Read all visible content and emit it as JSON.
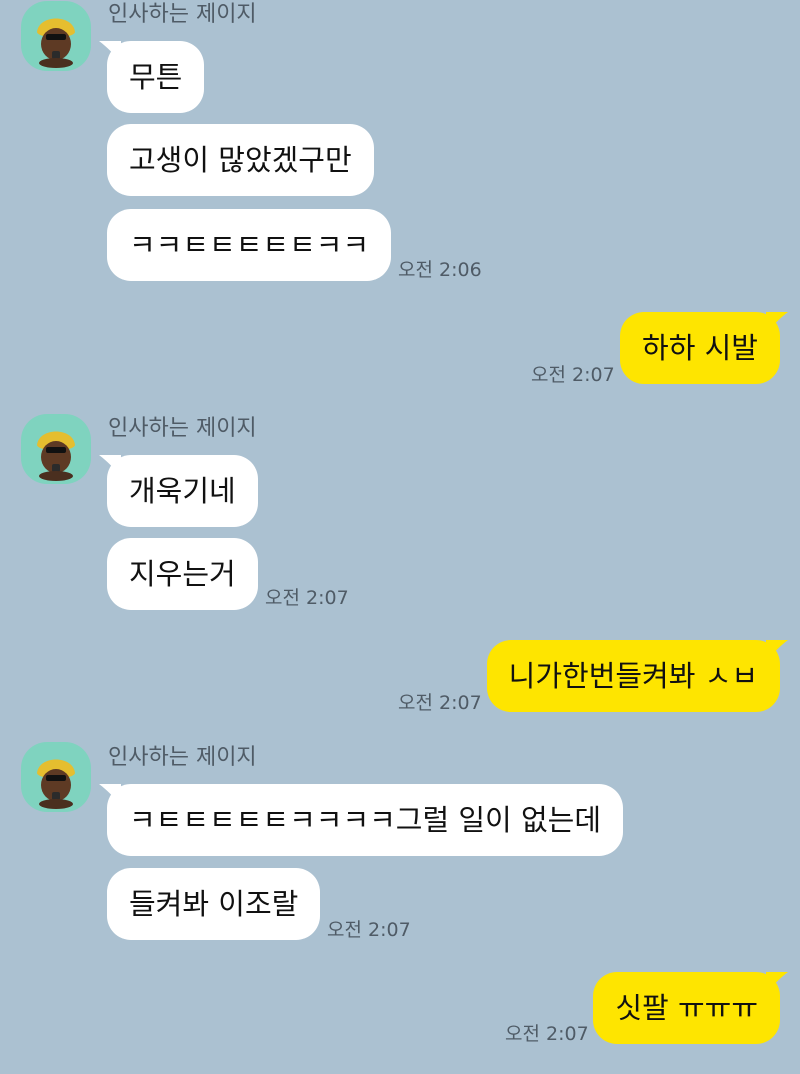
{
  "messages": [
    {
      "direction": "incoming",
      "sender": "인사하는 제이지",
      "bubbles": [
        "무튼",
        "고생이 많았겠구만",
        "ㅋㅋㅌㅌㅌㅌㅌㅋㅋ"
      ],
      "time": "오전 2:06"
    },
    {
      "direction": "outgoing",
      "bubbles": [
        "하하 시발"
      ],
      "time": "오전 2:07"
    },
    {
      "direction": "incoming",
      "sender": "인사하는 제이지",
      "bubbles": [
        "개욱기네",
        "지우는거"
      ],
      "time": "오전 2:07"
    },
    {
      "direction": "outgoing",
      "bubbles": [
        "니가한번들켜봐 ㅅㅂ"
      ],
      "time": "오전 2:07"
    },
    {
      "direction": "incoming",
      "sender": "인사하는 제이지",
      "bubbles": [
        "ㅋㅌㅌㅌㅌㅌㅋㅋㅋㅋ그럴 일이 없는데",
        "들켜봐 이조랄"
      ],
      "time": "오전 2:07"
    },
    {
      "direction": "outgoing",
      "bubbles": [
        "싯팔 ㅠㅠㅠ"
      ],
      "time": "오전 2:07"
    }
  ],
  "colors": {
    "background": "#abc1d1",
    "incoming_bubble": "#ffffff",
    "outgoing_bubble": "#fee500",
    "avatar_background": "#7fd3bf",
    "meta_text": "#4f5b66"
  },
  "icons": {
    "avatar": "character-avatar-icon"
  }
}
